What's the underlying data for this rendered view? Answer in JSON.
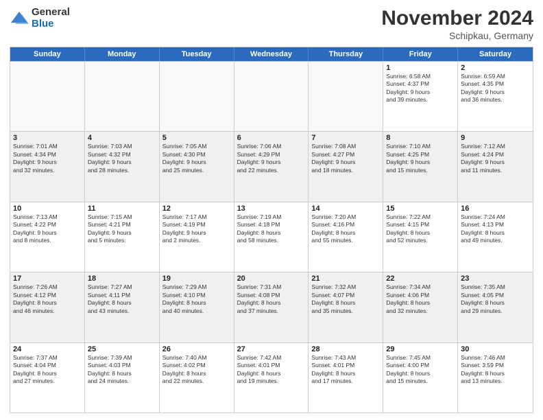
{
  "logo": {
    "general": "General",
    "blue": "Blue"
  },
  "header": {
    "month": "November 2024",
    "location": "Schipkau, Germany"
  },
  "days": [
    "Sunday",
    "Monday",
    "Tuesday",
    "Wednesday",
    "Thursday",
    "Friday",
    "Saturday"
  ],
  "rows": [
    [
      {
        "day": "",
        "info": ""
      },
      {
        "day": "",
        "info": ""
      },
      {
        "day": "",
        "info": ""
      },
      {
        "day": "",
        "info": ""
      },
      {
        "day": "",
        "info": ""
      },
      {
        "day": "1",
        "info": "Sunrise: 6:58 AM\nSunset: 4:37 PM\nDaylight: 9 hours\nand 39 minutes."
      },
      {
        "day": "2",
        "info": "Sunrise: 6:59 AM\nSunset: 4:35 PM\nDaylight: 9 hours\nand 36 minutes."
      }
    ],
    [
      {
        "day": "3",
        "info": "Sunrise: 7:01 AM\nSunset: 4:34 PM\nDaylight: 9 hours\nand 32 minutes."
      },
      {
        "day": "4",
        "info": "Sunrise: 7:03 AM\nSunset: 4:32 PM\nDaylight: 9 hours\nand 28 minutes."
      },
      {
        "day": "5",
        "info": "Sunrise: 7:05 AM\nSunset: 4:30 PM\nDaylight: 9 hours\nand 25 minutes."
      },
      {
        "day": "6",
        "info": "Sunrise: 7:06 AM\nSunset: 4:29 PM\nDaylight: 9 hours\nand 22 minutes."
      },
      {
        "day": "7",
        "info": "Sunrise: 7:08 AM\nSunset: 4:27 PM\nDaylight: 9 hours\nand 18 minutes."
      },
      {
        "day": "8",
        "info": "Sunrise: 7:10 AM\nSunset: 4:25 PM\nDaylight: 9 hours\nand 15 minutes."
      },
      {
        "day": "9",
        "info": "Sunrise: 7:12 AM\nSunset: 4:24 PM\nDaylight: 9 hours\nand 11 minutes."
      }
    ],
    [
      {
        "day": "10",
        "info": "Sunrise: 7:13 AM\nSunset: 4:22 PM\nDaylight: 9 hours\nand 8 minutes."
      },
      {
        "day": "11",
        "info": "Sunrise: 7:15 AM\nSunset: 4:21 PM\nDaylight: 9 hours\nand 5 minutes."
      },
      {
        "day": "12",
        "info": "Sunrise: 7:17 AM\nSunset: 4:19 PM\nDaylight: 9 hours\nand 2 minutes."
      },
      {
        "day": "13",
        "info": "Sunrise: 7:19 AM\nSunset: 4:18 PM\nDaylight: 8 hours\nand 58 minutes."
      },
      {
        "day": "14",
        "info": "Sunrise: 7:20 AM\nSunset: 4:16 PM\nDaylight: 8 hours\nand 55 minutes."
      },
      {
        "day": "15",
        "info": "Sunrise: 7:22 AM\nSunset: 4:15 PM\nDaylight: 8 hours\nand 52 minutes."
      },
      {
        "day": "16",
        "info": "Sunrise: 7:24 AM\nSunset: 4:13 PM\nDaylight: 8 hours\nand 49 minutes."
      }
    ],
    [
      {
        "day": "17",
        "info": "Sunrise: 7:26 AM\nSunset: 4:12 PM\nDaylight: 8 hours\nand 46 minutes."
      },
      {
        "day": "18",
        "info": "Sunrise: 7:27 AM\nSunset: 4:11 PM\nDaylight: 8 hours\nand 43 minutes."
      },
      {
        "day": "19",
        "info": "Sunrise: 7:29 AM\nSunset: 4:10 PM\nDaylight: 8 hours\nand 40 minutes."
      },
      {
        "day": "20",
        "info": "Sunrise: 7:31 AM\nSunset: 4:08 PM\nDaylight: 8 hours\nand 37 minutes."
      },
      {
        "day": "21",
        "info": "Sunrise: 7:32 AM\nSunset: 4:07 PM\nDaylight: 8 hours\nand 35 minutes."
      },
      {
        "day": "22",
        "info": "Sunrise: 7:34 AM\nSunset: 4:06 PM\nDaylight: 8 hours\nand 32 minutes."
      },
      {
        "day": "23",
        "info": "Sunrise: 7:35 AM\nSunset: 4:05 PM\nDaylight: 8 hours\nand 29 minutes."
      }
    ],
    [
      {
        "day": "24",
        "info": "Sunrise: 7:37 AM\nSunset: 4:04 PM\nDaylight: 8 hours\nand 27 minutes."
      },
      {
        "day": "25",
        "info": "Sunrise: 7:39 AM\nSunset: 4:03 PM\nDaylight: 8 hours\nand 24 minutes."
      },
      {
        "day": "26",
        "info": "Sunrise: 7:40 AM\nSunset: 4:02 PM\nDaylight: 8 hours\nand 22 minutes."
      },
      {
        "day": "27",
        "info": "Sunrise: 7:42 AM\nSunset: 4:01 PM\nDaylight: 8 hours\nand 19 minutes."
      },
      {
        "day": "28",
        "info": "Sunrise: 7:43 AM\nSunset: 4:01 PM\nDaylight: 8 hours\nand 17 minutes."
      },
      {
        "day": "29",
        "info": "Sunrise: 7:45 AM\nSunset: 4:00 PM\nDaylight: 8 hours\nand 15 minutes."
      },
      {
        "day": "30",
        "info": "Sunrise: 7:46 AM\nSunset: 3:59 PM\nDaylight: 8 hours\nand 13 minutes."
      }
    ]
  ]
}
